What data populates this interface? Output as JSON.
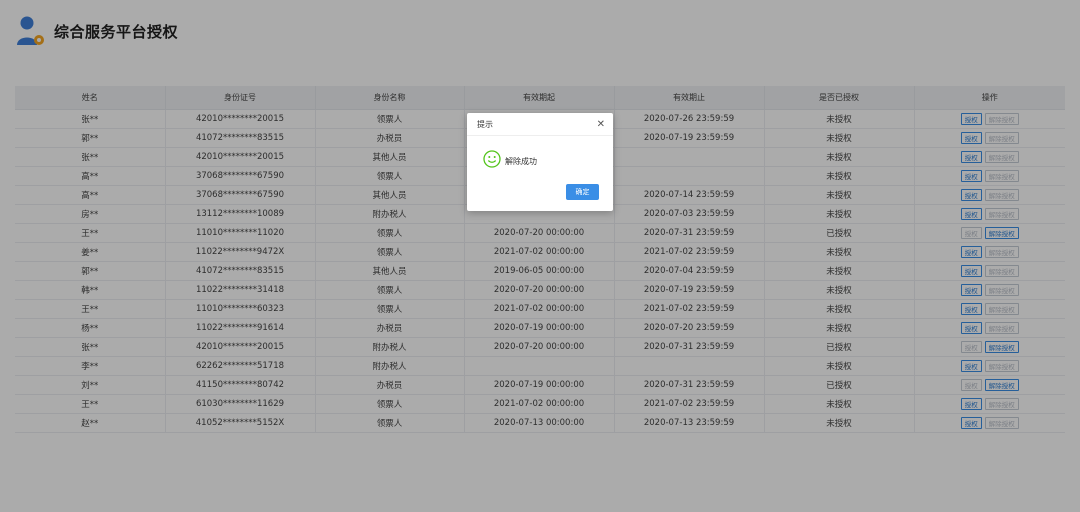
{
  "header": {
    "title": "综合服务平台授权"
  },
  "table": {
    "columns": [
      "姓名",
      "身份证号",
      "身份名称",
      "有效期起",
      "有效期止",
      "是否已授权",
      "操作"
    ],
    "auth_label": "授权",
    "revoke_label": "解除授权",
    "rows": [
      {
        "name": "张**",
        "id": "42010********20015",
        "role": "领票人",
        "start": "",
        "end": "2020-07-26 23:59:59",
        "status": "未授权",
        "auth_enabled": true,
        "revoke_enabled": false
      },
      {
        "name": "郭**",
        "id": "41072********83515",
        "role": "办税员",
        "start": "",
        "end": "2020-07-19 23:59:59",
        "status": "未授权",
        "auth_enabled": true,
        "revoke_enabled": false
      },
      {
        "name": "张**",
        "id": "42010********20015",
        "role": "其他人员",
        "start": "",
        "end": "",
        "status": "未授权",
        "auth_enabled": true,
        "revoke_enabled": false
      },
      {
        "name": "高**",
        "id": "37068********67590",
        "role": "领票人",
        "start": "",
        "end": "",
        "status": "未授权",
        "auth_enabled": true,
        "revoke_enabled": false
      },
      {
        "name": "高**",
        "id": "37068********67590",
        "role": "其他人员",
        "start": "",
        "end": "2020-07-14 23:59:59",
        "status": "未授权",
        "auth_enabled": true,
        "revoke_enabled": false
      },
      {
        "name": "房**",
        "id": "13112********10089",
        "role": "附办税人",
        "start": "",
        "end": "2020-07-03 23:59:59",
        "status": "未授权",
        "auth_enabled": true,
        "revoke_enabled": false
      },
      {
        "name": "王**",
        "id": "11010********11020",
        "role": "领票人",
        "start": "2020-07-20 00:00:00",
        "end": "2020-07-31 23:59:59",
        "status": "已授权",
        "auth_enabled": false,
        "revoke_enabled": true
      },
      {
        "name": "姜**",
        "id": "11022********9472X",
        "role": "领票人",
        "start": "2021-07-02 00:00:00",
        "end": "2021-07-02 23:59:59",
        "status": "未授权",
        "auth_enabled": true,
        "revoke_enabled": false
      },
      {
        "name": "郭**",
        "id": "41072********83515",
        "role": "其他人员",
        "start": "2019-06-05 00:00:00",
        "end": "2020-07-04 23:59:59",
        "status": "未授权",
        "auth_enabled": true,
        "revoke_enabled": false
      },
      {
        "name": "韩**",
        "id": "11022********31418",
        "role": "领票人",
        "start": "2020-07-20 00:00:00",
        "end": "2020-07-19 23:59:59",
        "status": "未授权",
        "auth_enabled": true,
        "revoke_enabled": false
      },
      {
        "name": "王**",
        "id": "11010********60323",
        "role": "领票人",
        "start": "2021-07-02 00:00:00",
        "end": "2021-07-02 23:59:59",
        "status": "未授权",
        "auth_enabled": true,
        "revoke_enabled": false
      },
      {
        "name": "杨**",
        "id": "11022********91614",
        "role": "办税员",
        "start": "2020-07-19 00:00:00",
        "end": "2020-07-20 23:59:59",
        "status": "未授权",
        "auth_enabled": true,
        "revoke_enabled": false
      },
      {
        "name": "张**",
        "id": "42010********20015",
        "role": "附办税人",
        "start": "2020-07-20 00:00:00",
        "end": "2020-07-31 23:59:59",
        "status": "已授权",
        "auth_enabled": false,
        "revoke_enabled": true
      },
      {
        "name": "李**",
        "id": "62262********51718",
        "role": "附办税人",
        "start": "",
        "end": "",
        "status": "未授权",
        "auth_enabled": true,
        "revoke_enabled": false
      },
      {
        "name": "刘**",
        "id": "41150********80742",
        "role": "办税员",
        "start": "2020-07-19 00:00:00",
        "end": "2020-07-31 23:59:59",
        "status": "已授权",
        "auth_enabled": false,
        "revoke_enabled": true
      },
      {
        "name": "王**",
        "id": "61030********11629",
        "role": "领票人",
        "start": "2021-07-02 00:00:00",
        "end": "2021-07-02 23:59:59",
        "status": "未授权",
        "auth_enabled": true,
        "revoke_enabled": false
      },
      {
        "name": "赵**",
        "id": "41052********5152X",
        "role": "领票人",
        "start": "2020-07-13 00:00:00",
        "end": "2020-07-13 23:59:59",
        "status": "未授权",
        "auth_enabled": true,
        "revoke_enabled": false
      }
    ]
  },
  "dialog": {
    "title": "提示",
    "close_glyph": "✕",
    "message": "解除成功",
    "ok_label": "确定"
  },
  "icons": {
    "logo": "user-settings-icon",
    "success": "smile-icon",
    "close": "close-icon"
  },
  "colors": {
    "accent": "#3a8ee6",
    "success": "#52c41a",
    "logo_blue": "#3f7fd8",
    "logo_gear": "#f5a623"
  }
}
